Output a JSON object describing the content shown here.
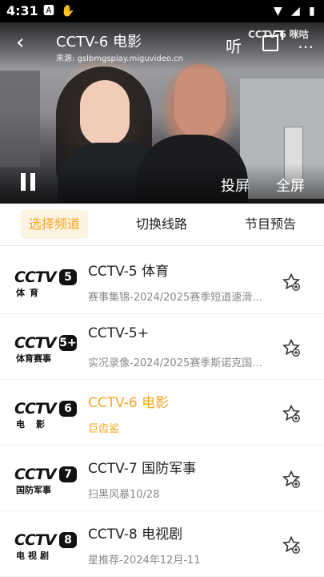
{
  "status_bar": {
    "time": "4:31",
    "icons": [
      "notification-a-icon",
      "hand-icon",
      "wifi-icon",
      "signal-icon",
      "battery-icon"
    ]
  },
  "player": {
    "title": "CCTV-6 电影",
    "source": "来源: gslbmgsplay.miguvideo.cn",
    "listen_label": "听",
    "watermark": "CCTV-6 咪咕",
    "cast_label": "投屏",
    "fullscreen_label": "全屏"
  },
  "tabs": [
    {
      "label": "选择频道",
      "active": true
    },
    {
      "label": "切换线路",
      "active": false
    },
    {
      "label": "节目预告",
      "active": false
    }
  ],
  "channels": [
    {
      "name": "CCTV-5 体育",
      "program": "赛事集锦-2024/2025赛季短道速滑世…",
      "logo_num": "5",
      "logo_sub": "体育",
      "active": false
    },
    {
      "name": "CCTV-5+",
      "program": "实况录像-2024/2025赛季斯诺克国际…",
      "logo_num": "5+",
      "logo_sub": "体育赛事",
      "active": false
    },
    {
      "name": "CCTV-6 电影",
      "program": "巨齿鲨",
      "logo_num": "6",
      "logo_sub": "电影",
      "active": true
    },
    {
      "name": "CCTV-7 国防军事",
      "program": "扫黑风暴10/28",
      "logo_num": "7",
      "logo_sub": "国防军事",
      "active": false
    },
    {
      "name": "CCTV-8 电视剧",
      "program": "星推荐-2024年12月-11",
      "logo_num": "8",
      "logo_sub": "电视剧",
      "active": false
    }
  ],
  "colors": {
    "accent": "#f5a623",
    "status_bar": "#000000"
  }
}
